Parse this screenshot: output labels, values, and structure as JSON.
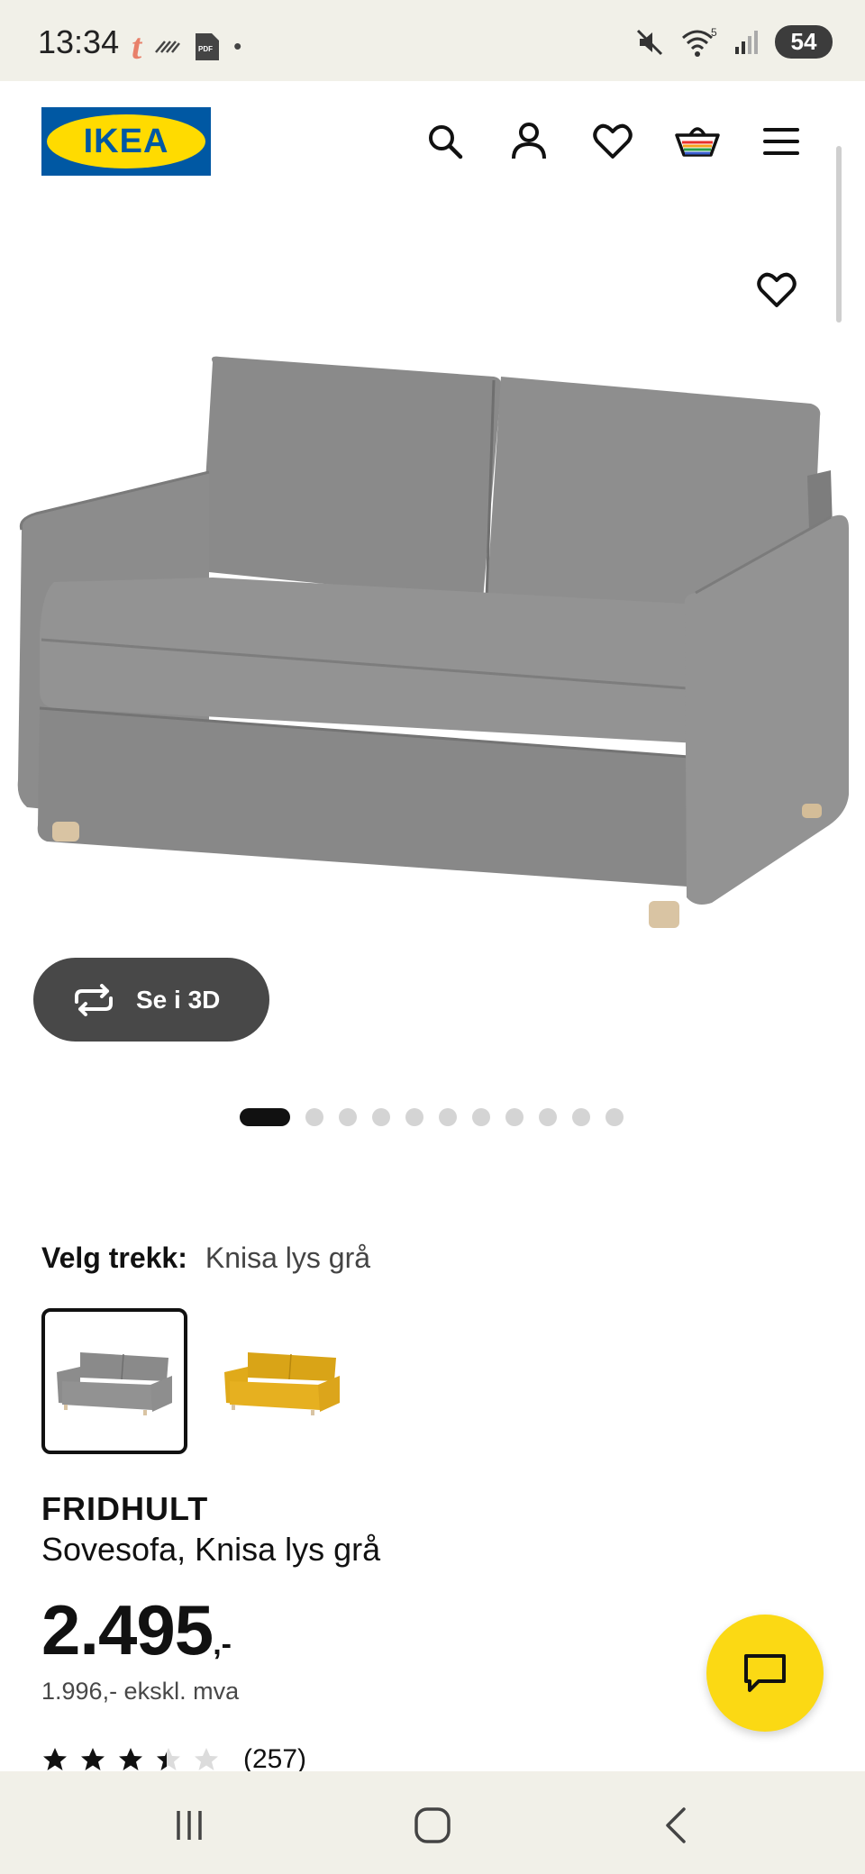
{
  "status_bar": {
    "time": "13:34",
    "battery": "54",
    "wifi_label": "5"
  },
  "header": {
    "logo_text": "IKEA",
    "icons": [
      "search-icon",
      "user-icon",
      "heart-icon",
      "basket-icon",
      "menu-icon"
    ]
  },
  "product": {
    "view_3d_label": "Se i 3D",
    "image_count": 12,
    "active_image_index": 0,
    "variant_label": "Velg trekk:",
    "variant_value": "Knisa lys grå",
    "swatches": [
      {
        "color": "#8e8e8e",
        "selected": true
      },
      {
        "color": "#e3ad1f",
        "selected": false
      }
    ],
    "name": "FRIDHULT",
    "description": "Sovesofa, Knisa lys grå",
    "price_integer": "2.495",
    "price_decimal": ",-",
    "price_ex_vat": "1.996,- ekskl. mva",
    "rating_value": 3.4,
    "rating_max": 5,
    "review_count": "(257)"
  },
  "colors": {
    "ikea_blue": "#0058a3",
    "ikea_yellow": "#ffdb00",
    "chat_yellow": "#fbd914",
    "sofa_gray": "#8e8e8e"
  }
}
